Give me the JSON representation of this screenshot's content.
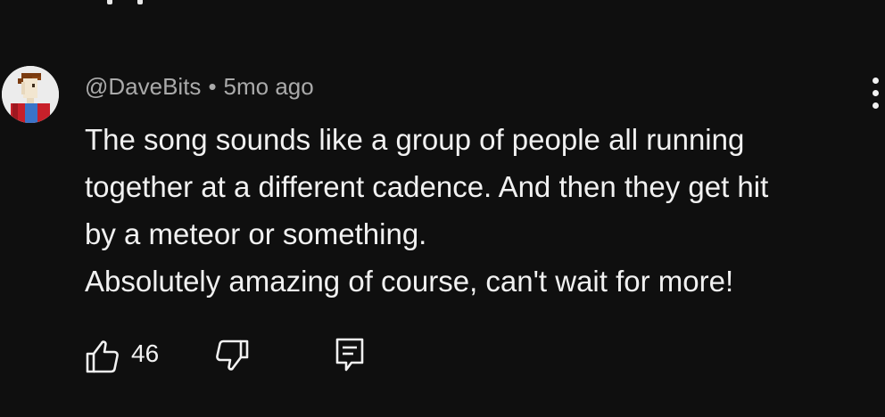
{
  "comment": {
    "handle": "@DaveBits",
    "separator": "•",
    "timestamp": "5mo ago",
    "lines": [
      "The song sounds like a group of people all running",
      "together at a different cadence. And then they get hit",
      "by a meteor or something.",
      "Absolutely amazing of course, can't wait for more!"
    ],
    "like_count": "46",
    "avatar_icon": "pixel-art-person-icon",
    "like_icon": "thumbs-up-icon",
    "dislike_icon": "thumbs-down-icon",
    "reply_icon": "reply-comment-icon",
    "menu_icon": "more-vertical-icon"
  }
}
